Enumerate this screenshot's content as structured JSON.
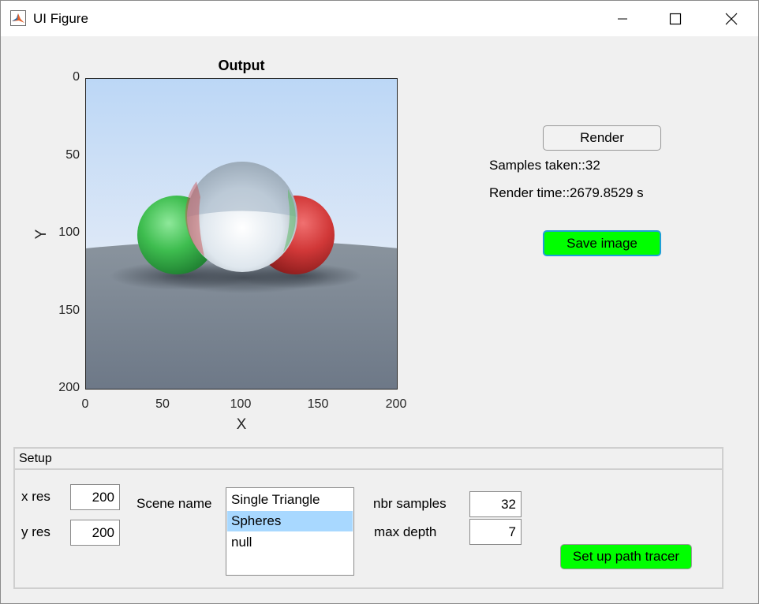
{
  "window": {
    "title": "UI Figure"
  },
  "axes": {
    "title": "Output",
    "xlabel": "X",
    "ylabel": "Y",
    "yticks": [
      "0",
      "50",
      "100",
      "150",
      "200"
    ],
    "xticks": [
      "0",
      "50",
      "100",
      "150",
      "200"
    ],
    "image": "rendered path-traced scene: green sphere, glass sphere, red sphere on grey ground under light blue sky"
  },
  "controls": {
    "render_label": "Render",
    "samples_taken": "Samples taken::32",
    "render_time": "Render time::2679.8529 s",
    "save_label": "Save image",
    "save_color": "#00ff00"
  },
  "setup": {
    "title": "Setup",
    "xres_label": "x res",
    "xres_value": "200",
    "yres_label": "y res",
    "yres_value": "200",
    "scene_label": "Scene name",
    "scenes": [
      "Single Triangle",
      "Spheres",
      "null"
    ],
    "selected_scene": "Spheres",
    "nbr_samples_label": "nbr samples",
    "nbr_samples_value": "32",
    "max_depth_label": "max depth",
    "max_depth_value": "7",
    "setup_button_label": "Set up path tracer"
  }
}
